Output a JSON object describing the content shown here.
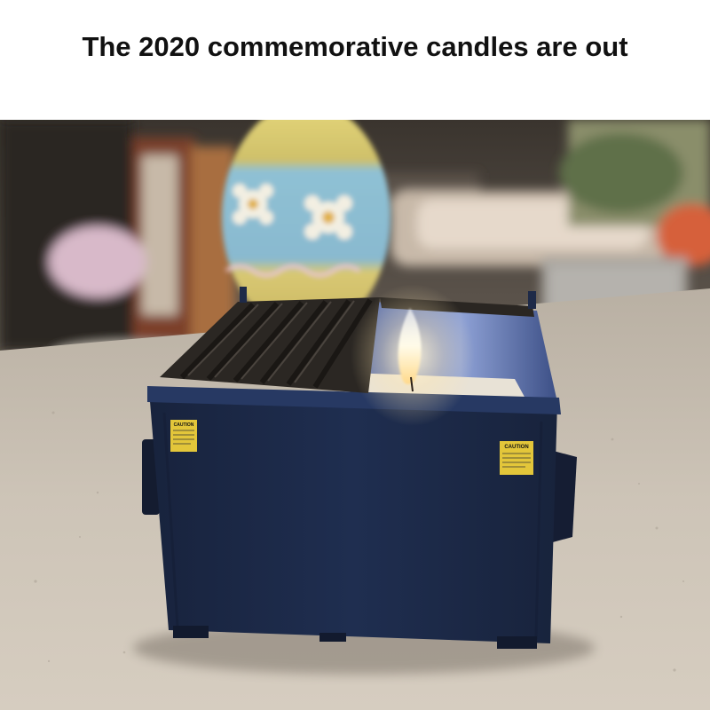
{
  "caption": "The 2020 commemorative candles are out",
  "photo": {
    "left_label": "CAUTION",
    "right_label": "CAUTION"
  },
  "colors": {
    "dumpster": "#1c2c4e",
    "lid": "#2a2622",
    "counter": "#ccc3b6",
    "flame": "#fff6d0",
    "egg": "#8fc1d4"
  }
}
